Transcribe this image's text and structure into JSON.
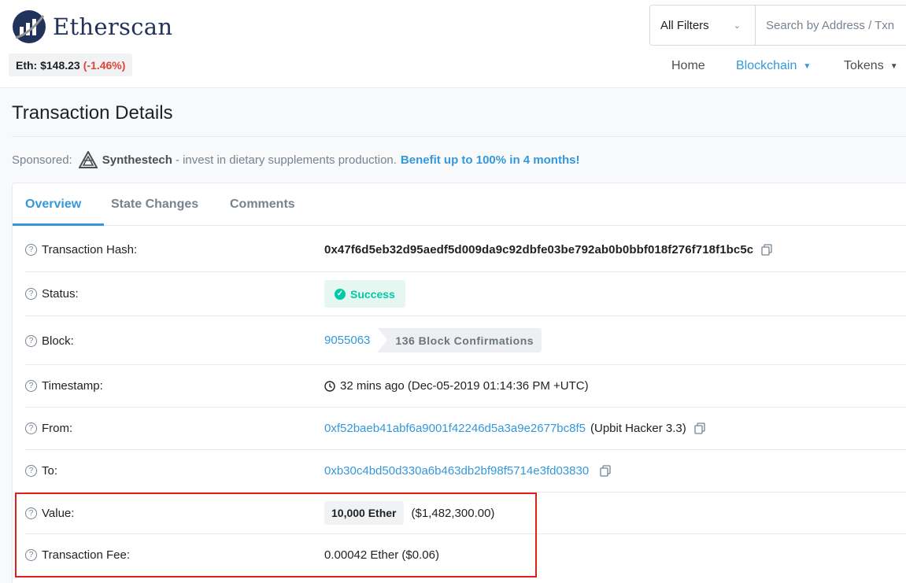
{
  "header": {
    "brand": "Etherscan",
    "price_label": "Eth: $148.23",
    "price_change": "(-1.46%)",
    "colors": {
      "brand": "#21325b",
      "accent": "#3498db",
      "negative": "#de4437"
    }
  },
  "search": {
    "filter_label": "All Filters",
    "placeholder": "Search by Address / Txn"
  },
  "nav": {
    "home": "Home",
    "blockchain": "Blockchain",
    "tokens": "Tokens"
  },
  "page": {
    "title": "Transaction Details"
  },
  "sponsor": {
    "prefix": "Sponsored:",
    "name": "Synthestech",
    "text": "- invest in dietary supplements production.",
    "link": "Benefit up to 100% in 4 months!"
  },
  "tabs": {
    "overview": "Overview",
    "state_changes": "State Changes",
    "comments": "Comments"
  },
  "details": {
    "hash_label": "Transaction Hash:",
    "hash_value": "0x47f6d5eb32d95aedf5d009da9c92dbfe03be792ab0b0bbf018f276f718f1bc5c",
    "status_label": "Status:",
    "status_value": "Success",
    "block_label": "Block:",
    "block_value": "9055063",
    "block_confirmations": "136 Block Confirmations",
    "timestamp_label": "Timestamp:",
    "timestamp_value": "32 mins ago (Dec-05-2019 01:14:36 PM +UTC)",
    "from_label": "From:",
    "from_address": "0xf52baeb41abf6a9001f42246d5a3a9e2677bc8f5",
    "from_tag": "(Upbit Hacker 3.3)",
    "to_label": "To:",
    "to_address": "0xb30c4bd50d330a6b463db2bf98f5714e3fd03830",
    "value_label": "Value:",
    "value_amount": "10,000 Ether",
    "value_usd": "($1,482,300.00)",
    "fee_label": "Transaction Fee:",
    "fee_value": "0.00042 Ether ($0.06)"
  }
}
